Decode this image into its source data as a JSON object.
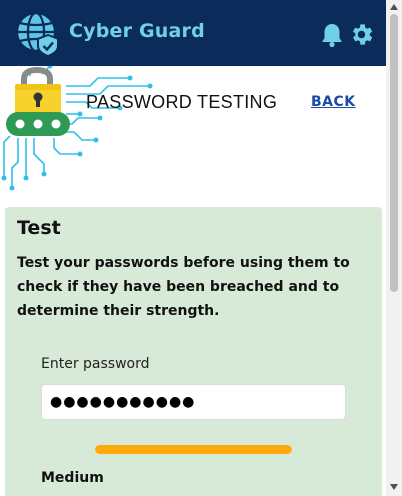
{
  "header": {
    "app_title": "Cyber Guard",
    "icons": [
      "globe-shield-icon",
      "bell-icon",
      "gear-icon"
    ]
  },
  "page": {
    "heading": "PASSWORD TESTING",
    "back_label": "BACK"
  },
  "card": {
    "title": "Test",
    "description": "Test your passwords before using them to check if they have been breached and to determine their strength.",
    "field_label": "Enter password",
    "password_value": "●●●●●●●●●●●",
    "strength_label": "Medium",
    "strength_level": 1.0
  },
  "colors": {
    "header_bg": "#0b2b5b",
    "title_accent": "#6fd0e6",
    "card_bg": "#d6ead7",
    "strength_medium": "#ffa90a",
    "link": "#1a4ba8"
  }
}
